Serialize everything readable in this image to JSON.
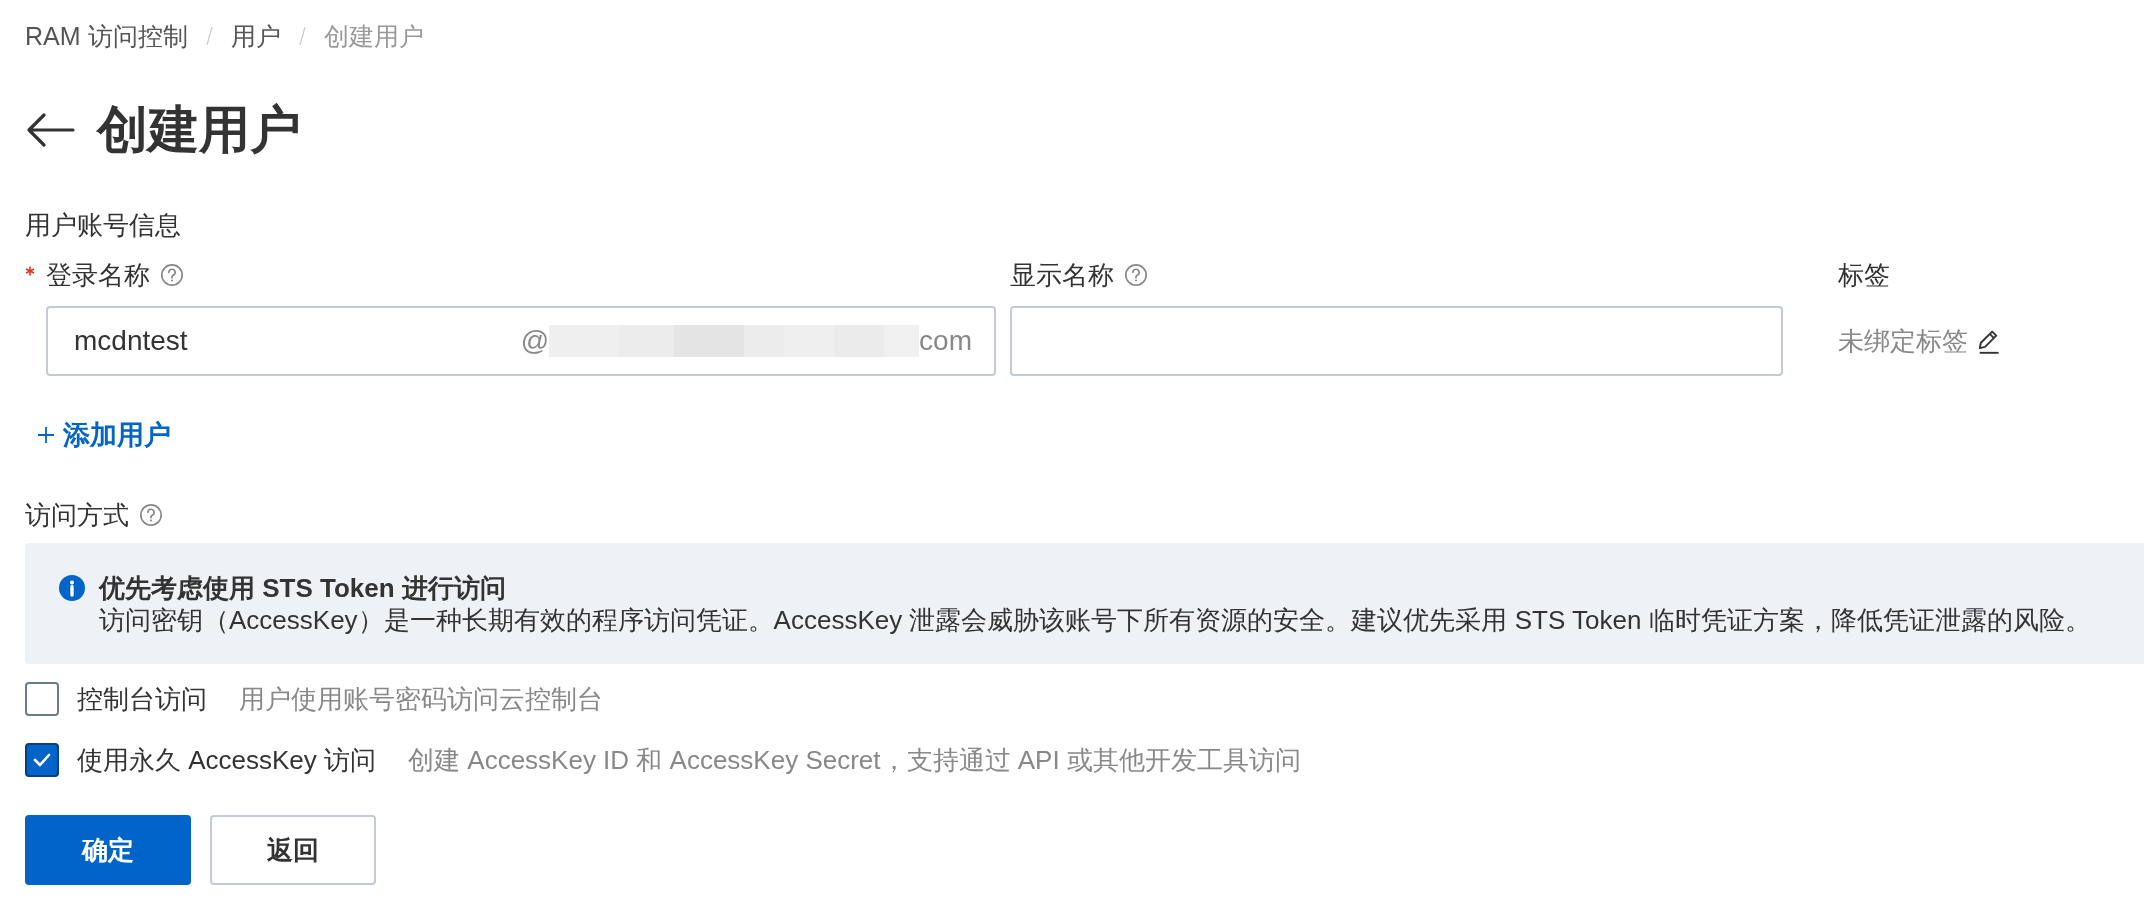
{
  "breadcrumb": [
    {
      "label": "RAM 访问控制",
      "current": false
    },
    {
      "label": "用户",
      "current": false
    },
    {
      "label": "创建用户",
      "current": true
    }
  ],
  "page_title": "创建用户",
  "section_title": "用户账号信息",
  "fields": [
    {
      "kind": "domain",
      "label": "登录名称",
      "required": true,
      "help": true,
      "value": "mcdntest",
      "prefix": "@",
      "suffix": "com"
    },
    {
      "kind": "text",
      "label": "显示名称",
      "required": false,
      "help": true
    },
    {
      "kind": "tags",
      "label": "标签",
      "required": false,
      "help": false,
      "value": "未绑定标签"
    }
  ],
  "add_user": "添加用户",
  "access_section": {
    "label": "访问方式",
    "help": true
  },
  "alert": {
    "title": "优先考虑使用 STS Token 进行访问",
    "body": "访问密钥（AccessKey）是一种长期有效的程序访问凭证。AccessKey 泄露会威胁该账号下所有资源的安全。建议优先采用 STS Token 临时凭证方案，降低凭证泄露的风险。"
  },
  "access_options": [
    {
      "label": "控制台访问",
      "description": "用户使用账号密码访问云控制台",
      "checked": false
    },
    {
      "label": "使用永久 AccessKey 访问",
      "description": "创建 AccessKey ID 和 AccessKey Secret，支持通过 API 或其他开发工具访问",
      "checked": true
    }
  ],
  "buttons": [
    {
      "label": "确定",
      "kind": "primary"
    },
    {
      "label": "返回",
      "kind": "secondary"
    }
  ]
}
